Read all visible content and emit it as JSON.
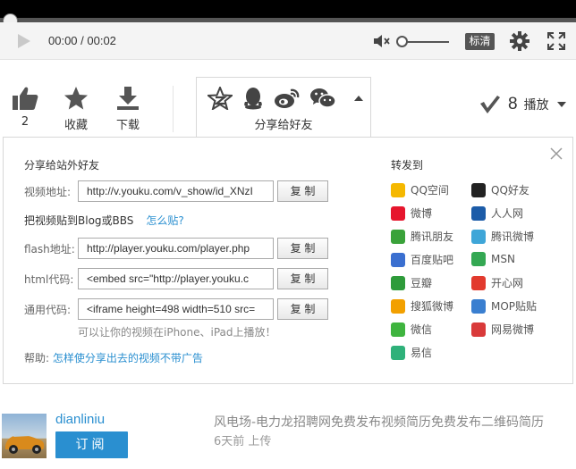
{
  "player": {
    "time": "00:00 / 00:02",
    "quality_label": "标清",
    "icons": [
      "play-icon",
      "volume-mute-icon",
      "gear-icon",
      "fullscreen-icon"
    ]
  },
  "actions": {
    "like_count": "2",
    "favorite_label": "收藏",
    "download_label": "下载",
    "share_tab_label": "分享给好友",
    "play_count": "8",
    "play_label": "播放"
  },
  "share": {
    "external_title": "分享给站外好友",
    "video_url_label": "视频地址:",
    "video_url_value": "http://v.youku.com/v_show/id_XNzI",
    "copy_label": "复 制",
    "embed_title": "把视频贴到Blog或BBS",
    "howto_link": "怎么贴?",
    "flash_label": "flash地址:",
    "flash_value": "http://player.youku.com/player.php",
    "html_label": "html代码:",
    "html_value": "<embed src=\"http://player.youku.c",
    "generic_label": "通用代码:",
    "generic_value": "<iframe height=498 width=510 src=",
    "hint": "可以让你的视频在iPhone、iPad上播放！",
    "help_label": "帮助:",
    "help_link": "怎样使分享出去的视频不带广告"
  },
  "forward": {
    "title": "转发到",
    "sites": [
      {
        "name": "QQ空间",
        "icon": "qzone-icon",
        "color": "#f5b800"
      },
      {
        "name": "QQ好友",
        "icon": "qq-icon",
        "color": "#222222"
      },
      {
        "name": "微博",
        "icon": "weibo-icon",
        "color": "#e6162d"
      },
      {
        "name": "人人网",
        "icon": "renren-icon",
        "color": "#1c5ca8"
      },
      {
        "name": "腾讯朋友",
        "icon": "pengyou-icon",
        "color": "#3aa23a"
      },
      {
        "name": "腾讯微博",
        "icon": "tencent-weibo-icon",
        "color": "#3fa6d8"
      },
      {
        "name": "百度贴吧",
        "icon": "tieba-icon",
        "color": "#3a6fd0"
      },
      {
        "name": "MSN",
        "icon": "msn-icon",
        "color": "#34a853"
      },
      {
        "name": "豆瓣",
        "icon": "douban-icon",
        "color": "#2e9b3a"
      },
      {
        "name": "开心网",
        "icon": "kaixin-icon",
        "color": "#e23a2e"
      },
      {
        "name": "搜狐微博",
        "icon": "sohu-weibo-icon",
        "color": "#f2a000"
      },
      {
        "name": "MOP贴贴",
        "icon": "mop-icon",
        "color": "#3a7fd0"
      },
      {
        "name": "微信",
        "icon": "wechat-icon",
        "color": "#3fb43f"
      },
      {
        "name": "网易微博",
        "icon": "netease-weibo-icon",
        "color": "#d93a3a"
      },
      {
        "name": "易信",
        "icon": "yixin-icon",
        "color": "#2fb17a"
      }
    ]
  },
  "uploader": {
    "name": "dianliniu",
    "subscribe_label": "订阅",
    "description": "风电场-电力龙招聘网免费发布视频简历免费发布二维码简历",
    "meta": "6天前 上传"
  },
  "colors": {
    "link": "#2a8fd0",
    "button": "#2a8fd0",
    "border": "#d8d8d8"
  }
}
